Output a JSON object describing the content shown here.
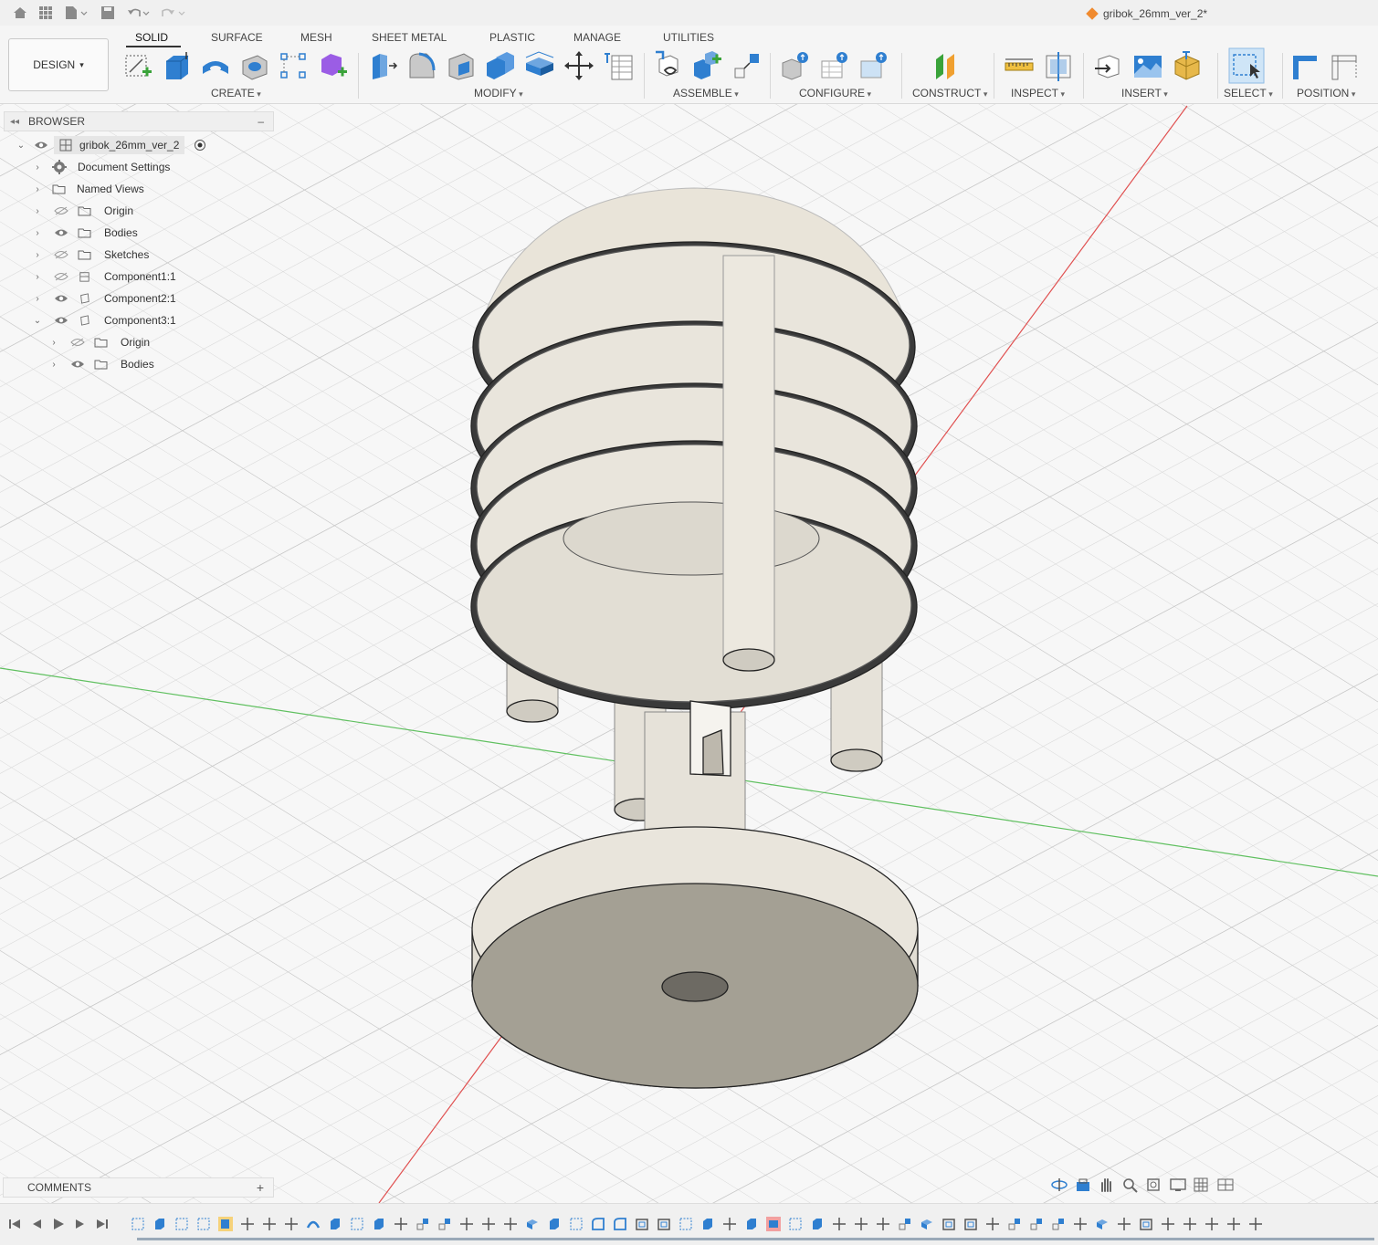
{
  "app": {
    "document_title": "gribok_26mm_ver_2*"
  },
  "toolbar": {
    "workspace_label": "DESIGN",
    "tabs": [
      "SOLID",
      "SURFACE",
      "MESH",
      "SHEET METAL",
      "PLASTIC",
      "MANAGE",
      "UTILITIES"
    ],
    "active_tab": "SOLID",
    "groups": [
      "CREATE",
      "MODIFY",
      "ASSEMBLE",
      "CONFIGURE",
      "CONSTRUCT",
      "INSPECT",
      "INSERT",
      "SELECT",
      "POSITION"
    ]
  },
  "browser": {
    "title": "BROWSER",
    "root": "gribok_26mm_ver_2",
    "items": [
      {
        "label": "Document Settings",
        "icon": "gear-icon"
      },
      {
        "label": "Named Views",
        "icon": "folder-icon"
      },
      {
        "label": "Origin",
        "icon": "folder-icon",
        "visibility": "hidden"
      },
      {
        "label": "Bodies",
        "icon": "folder-icon",
        "visibility": "visible"
      },
      {
        "label": "Sketches",
        "icon": "folder-icon",
        "visibility": "hidden"
      },
      {
        "label": "Component1:1",
        "icon": "component-icon",
        "visibility": "hidden"
      },
      {
        "label": "Component2:1",
        "icon": "component-icon",
        "visibility": "visible"
      },
      {
        "label": "Component3:1",
        "icon": "component-icon",
        "visibility": "visible",
        "expanded": true
      },
      {
        "label": "Origin",
        "icon": "folder-icon",
        "visibility": "hidden",
        "child": true
      },
      {
        "label": "Bodies",
        "icon": "folder-icon",
        "visibility": "visible",
        "child": true
      }
    ]
  },
  "comments": {
    "label": "COMMENTS"
  },
  "colors": {
    "accent_blue": "#2f7fd0",
    "model_fill": "#e9e5dc",
    "model_shadow": "#cfcbc1",
    "axis_red": "#e05050",
    "axis_green": "#60c060"
  }
}
